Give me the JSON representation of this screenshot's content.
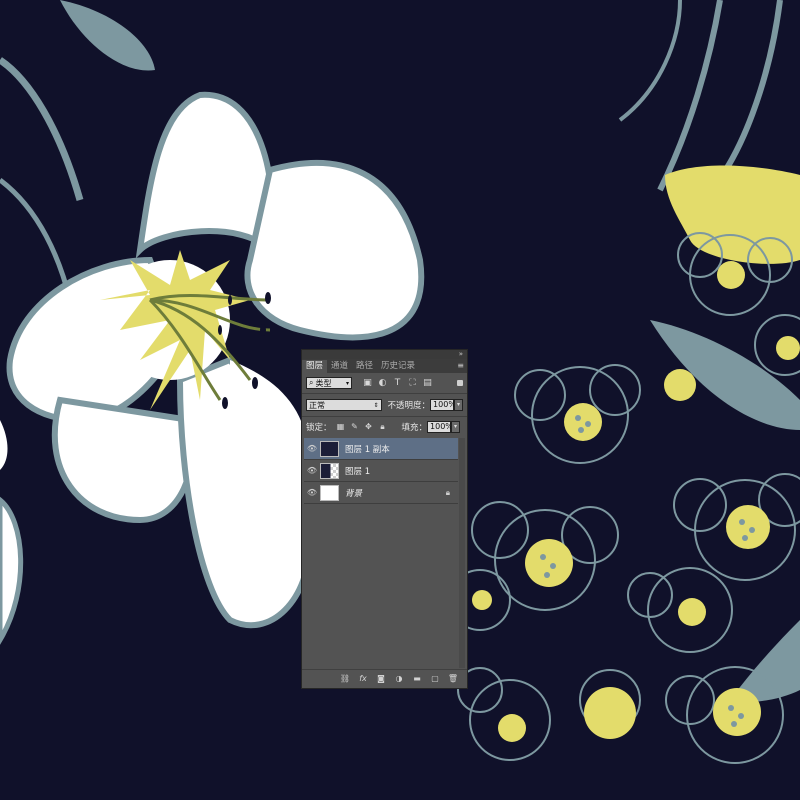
{
  "panel": {
    "tabs": [
      {
        "label": "图层",
        "active": true
      },
      {
        "label": "通道",
        "active": false
      },
      {
        "label": "路径",
        "active": false
      },
      {
        "label": "历史记录",
        "active": false
      }
    ],
    "collapse_icon": "double-chevron-icon",
    "menu_icon": "panel-menu-icon",
    "filter": {
      "label": "类型",
      "icons": [
        "pixel-filter-icon",
        "adjustment-filter-icon",
        "type-filter-icon",
        "shape-filter-icon",
        "smart-object-filter-icon"
      ]
    },
    "blend_mode": "正常",
    "opacity_label": "不透明度：",
    "opacity_value": "100%",
    "lock_label": "锁定：",
    "lock_icons": [
      "lock-transparent-icon",
      "lock-image-icon",
      "lock-position-icon",
      "lock-all-icon"
    ],
    "fill_label": "填充：",
    "fill_value": "100%",
    "layers": [
      {
        "name": "图层 1 副本",
        "selected": true,
        "visible": true,
        "thumb": "dark"
      },
      {
        "name": "图层 1",
        "selected": false,
        "visible": true,
        "thumb": "dark-checker"
      },
      {
        "name": "背景",
        "selected": false,
        "visible": true,
        "thumb": "white",
        "locked": true
      }
    ],
    "bottom_icons": [
      "link-layers-icon",
      "fx-icon",
      "add-mask-icon",
      "adjustment-layer-icon",
      "new-group-icon",
      "new-layer-icon",
      "delete-icon"
    ]
  },
  "colors": {
    "canvas_bg": "#10112a",
    "lily_white": "#ffffff",
    "outline_blue": "#7d98a0",
    "pollen_yellow": "#e3dc6b",
    "panel_bg": "#535353",
    "selected_row": "#5e6f86"
  }
}
